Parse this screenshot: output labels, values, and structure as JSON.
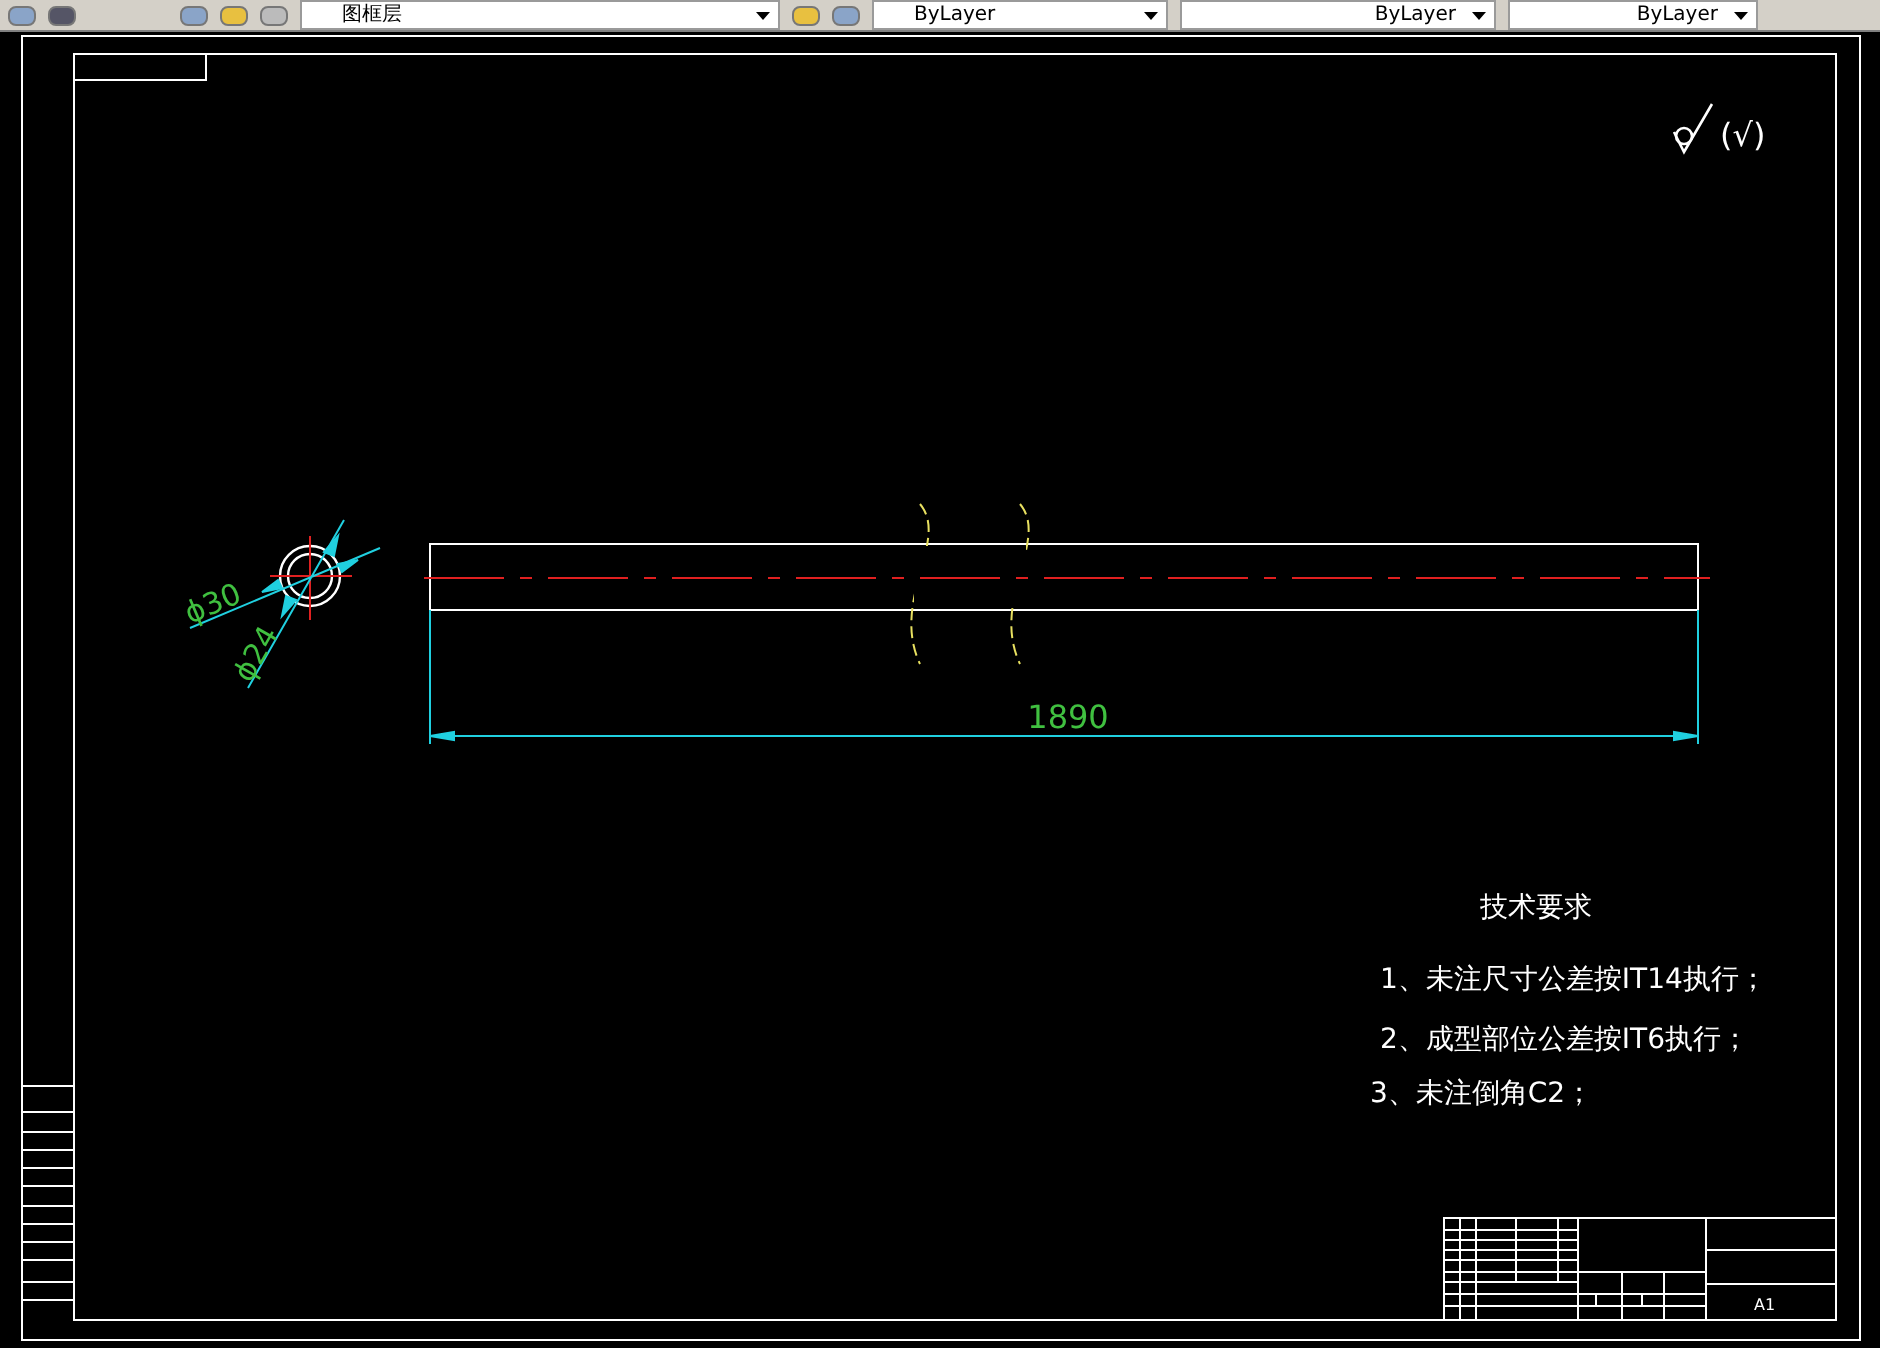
{
  "toolbar": {
    "layer": "图框层",
    "color_setting": "ByLayer",
    "linetype": "ByLayer",
    "lineweight": "ByLayer"
  },
  "drawing": {
    "roughness": "(√)",
    "dim_outer": "ϕ30",
    "dim_inner": "ϕ24",
    "dim_length": "1890",
    "notes": {
      "title": "技术要求",
      "items": [
        "1、未注尺寸公差按IT14执行；",
        "2、成型部位公差按IT6执行；",
        "3、未注倒角C2；"
      ]
    },
    "title_block": {
      "sheet_size": "A1"
    }
  }
}
